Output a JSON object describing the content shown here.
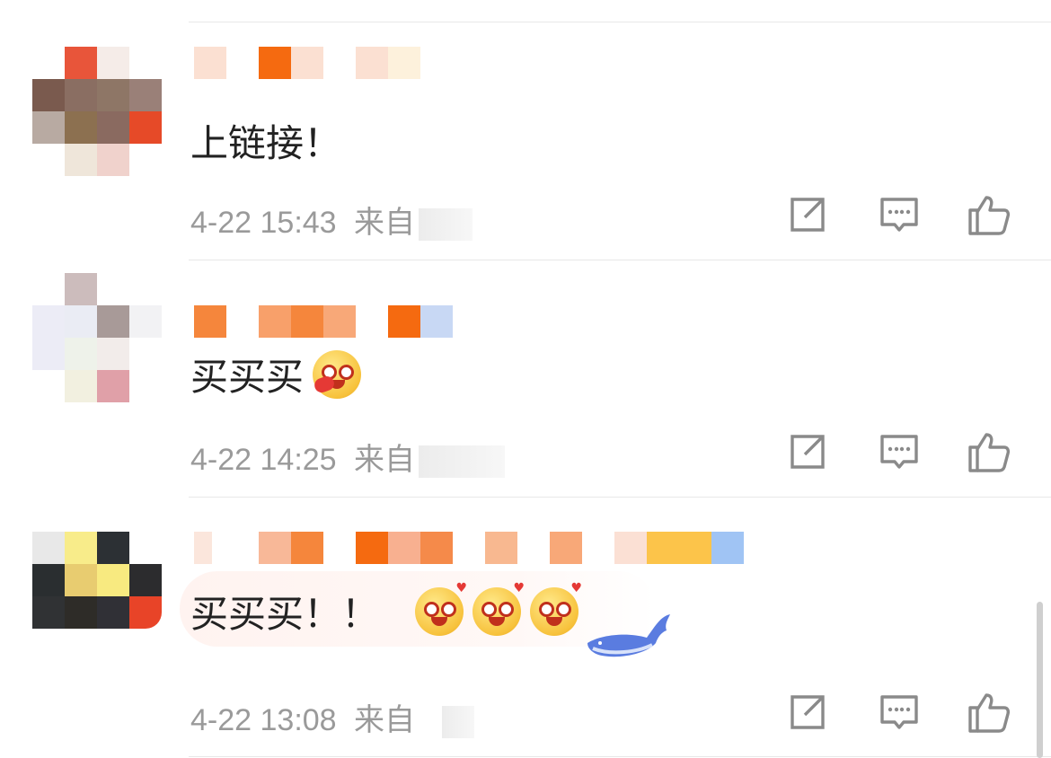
{
  "comments": [
    {
      "text": "上链接！",
      "time": "4-22 15:43",
      "source": "来自"
    },
    {
      "text": "买买买",
      "time": "4-22 14:25",
      "source": "来自"
    },
    {
      "text": "买买买！！",
      "time": "4-22 13:08",
      "source": "来自"
    }
  ],
  "icons": {
    "share": "share-icon",
    "reply": "comment-icon",
    "like": "thumbs-up-icon"
  },
  "colors": {
    "text": "#222222",
    "meta": "#9a9a9a",
    "divider": "#e8e8e8",
    "accent": "#f26b1d"
  }
}
